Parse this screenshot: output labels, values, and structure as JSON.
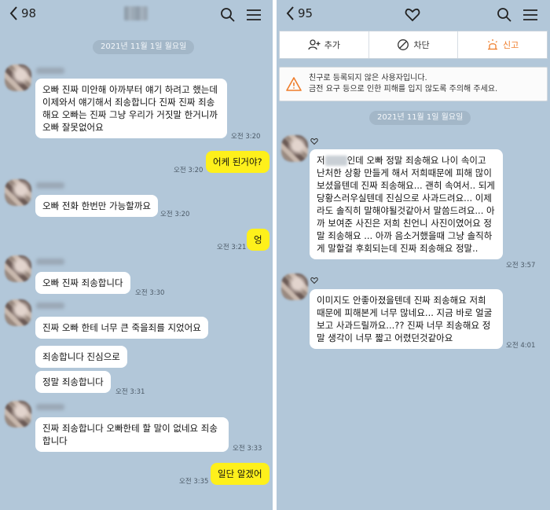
{
  "left": {
    "header": {
      "count": "98"
    },
    "date": "2021년 11월 1일 월요일",
    "messages": [
      {
        "text": "오빠 진짜 미안해 아까부터 얘기 하려고 했는데 이제와서 얘기해서 죄송합니다 진짜 진짜 죄송해요 오빠는 진짜 그냥 우리가 거짓말 한거니까 오빠 잘못없어요",
        "time": "오전 3:20"
      },
      {
        "text": "어케 된거야?",
        "time": "오전 3:20"
      },
      {
        "text": "오빠 전화 한번만 가능할까요",
        "time": "오전 3:20"
      },
      {
        "text": "엉",
        "time": "오전 3:21"
      },
      {
        "text": "오빠 진짜 죄송합니다",
        "time": "오전 3:30"
      },
      {
        "text": "진짜 오빠 한테 너무 큰 죽을죄를 지었어요",
        "time": ""
      },
      {
        "text": "죄송합니다 진심으로",
        "time": ""
      },
      {
        "text": "정말 죄송합니다",
        "time": "오전 3:31"
      },
      {
        "text": "진짜 죄송합니다 오빠한테 할 말이 없네요 죄송합니다",
        "time": "오전 3:33"
      },
      {
        "text": "일단 알겠어",
        "time": "오전 3:35"
      }
    ]
  },
  "right": {
    "header": {
      "count": "95"
    },
    "actions": {
      "add": "추가",
      "block": "차단",
      "report": "신고"
    },
    "warning": {
      "line1": "친구로 등록되지 않은 사용자입니다.",
      "line2": "금전 요구 등으로 인한 피해를 입지 않도록 주의해 주세요."
    },
    "date": "2021년 11월 1일 월요일",
    "messages": [
      {
        "prefix": "저",
        "text": "인데 오빠 정말 죄송해요 나이 속이고 난처한 상황 만들게 해서 저희때문에 피해 많이 보셨을텐데 진짜 죄송해요... 괜히 속여서.. 되게 당황스러우실텐데 진심으로 사과드려요... 이제라도 솔직히 말해야될것같아서 말씀드려요... 아까 보여준 사진은 저희 친언니 사진이였어요 정말 죄송해요 ... 아까 음소거했을때 그냥 솔직하게 말할걸 후회되는데 진짜 죄송해요 정말..",
        "time": "오전 3:57"
      },
      {
        "text": "이미지도 안좋아졌을텐데 진짜 죄송해요 저희 때문에 피해본게 너무 많네요... 지금 바로 얼굴 보고 사과드릴까요...?? 진짜 너무 죄송해요 정말 생각이 너무 짧고 어렸던것같아요",
        "time": "오전 4:01"
      }
    ]
  },
  "colors": {
    "chat_bg": "#b2c7d9",
    "my_bubble": "#fef01b",
    "their_bubble": "#ffffff",
    "report": "#ef7d2b"
  }
}
